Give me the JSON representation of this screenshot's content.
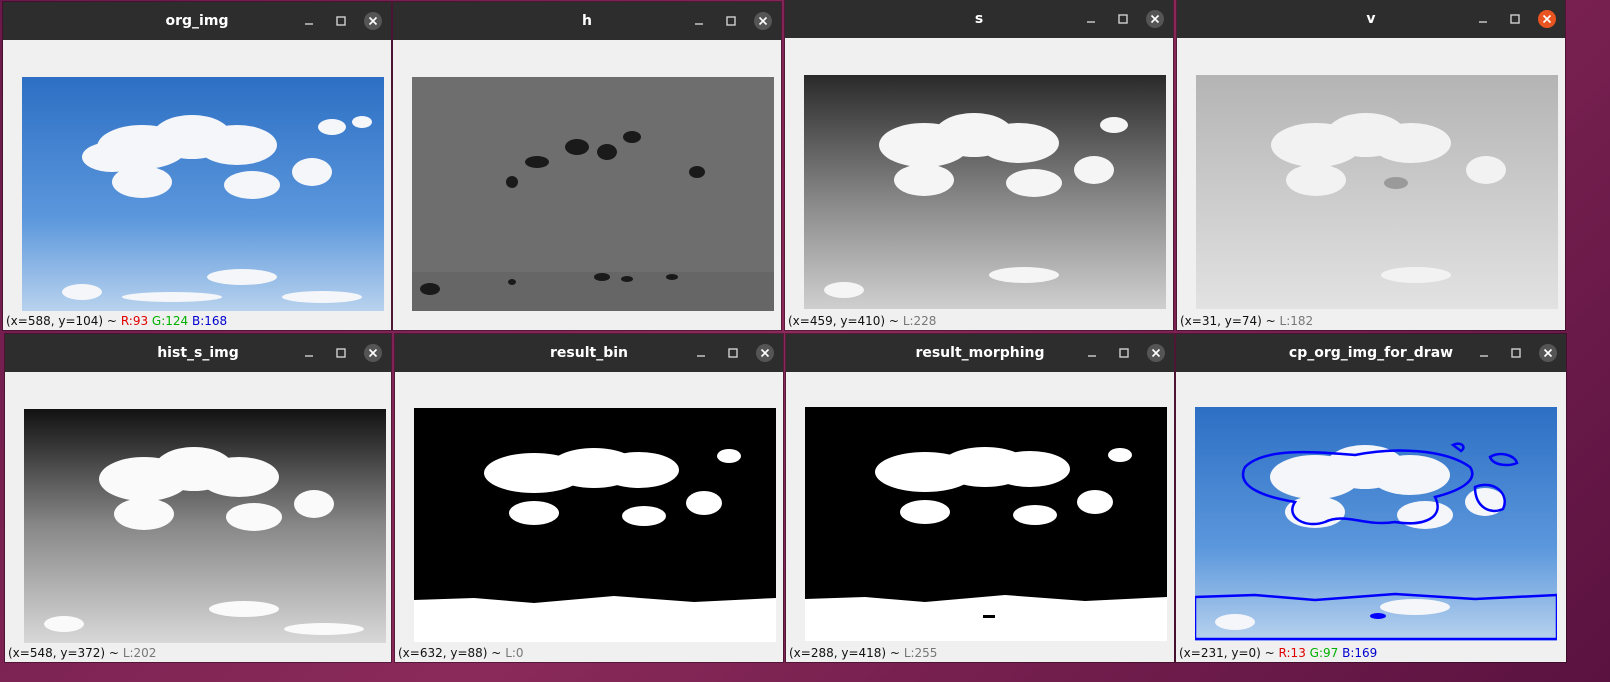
{
  "windows": [
    {
      "title": "org_img",
      "coords": "(x=588, y=104) ~",
      "type": "rgb",
      "r": "R:93",
      "g": "G:124",
      "b": "B:168"
    },
    {
      "title": "h",
      "coords": "",
      "type": "none"
    },
    {
      "title": "s",
      "coords": "(x=459, y=410) ~",
      "type": "gray",
      "l": "L:228"
    },
    {
      "title": "v",
      "coords": "(x=31, y=74) ~",
      "type": "gray",
      "l": "L:182",
      "active": true
    },
    {
      "title": "hist_s_img",
      "coords": "(x=548, y=372) ~",
      "type": "gray",
      "l": "L:202"
    },
    {
      "title": "result_bin",
      "coords": "(x=632, y=88) ~",
      "type": "gray",
      "l": "L:0"
    },
    {
      "title": "result_morphing",
      "coords": "(x=288, y=418) ~",
      "type": "gray",
      "l": "L:255"
    },
    {
      "title": "cp_org_img_for_draw",
      "coords": "(x=231, y=0) ~",
      "type": "rgb",
      "r": "R:13",
      "g": "G:97",
      "b": "B:169"
    }
  ],
  "icons": {
    "minimize": "minimize-icon",
    "maximize": "maximize-icon",
    "close": "close-icon"
  },
  "colors": {
    "titlebar": "#2d2d2d",
    "close_active": "#e95420",
    "contour": "#0000ff",
    "desktop": "#7a1f50"
  }
}
